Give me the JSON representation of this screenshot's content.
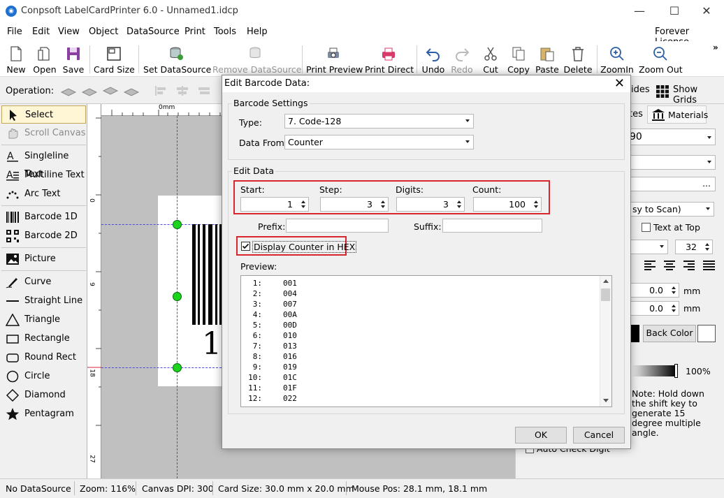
{
  "window": {
    "title": "Conpsoft LabelCardPrinter 6.0 - Unnamed1.idcp",
    "license": "Forever License"
  },
  "menu": [
    "File",
    "Edit",
    "View",
    "Object",
    "DataSource",
    "Print",
    "Tools",
    "Help"
  ],
  "toolbar": {
    "new": "New",
    "open": "Open",
    "save": "Save",
    "card_size": "Card Size",
    "set_datasource": "Set DataSource",
    "remove_datasource": "Remove DataSource",
    "print_preview": "Print Preview",
    "print_direct": "Print Direct",
    "undo": "Undo",
    "redo": "Redo",
    "cut": "Cut",
    "copy": "Copy",
    "paste": "Paste",
    "delete": "Delete",
    "zoom_in": "ZoomIn",
    "zoom_out": "Zoom Out",
    "more": "»"
  },
  "operation_label": "Operation:",
  "guides_label": "ides",
  "show_grids_label": "Show Grids",
  "tools": {
    "select": "Select",
    "scroll_canvas": "Scroll Canvas",
    "singleline_text": "Singleline Text",
    "multiline_text": "Multiline Text",
    "arc_text": "Arc Text",
    "barcode_1d": "Barcode 1D",
    "barcode_2d": "Barcode 2D",
    "picture": "Picture",
    "curve": "Curve",
    "straight_line": "Straight Line",
    "triangle": "Triangle",
    "rectangle": "Rectangle",
    "round_rect": "Round Rect",
    "circle": "Circle",
    "diamond": "Diamond",
    "pentagram": "Pentagram"
  },
  "ruler": {
    "top_origin": "0mm",
    "left": [
      "0",
      "9",
      "18",
      "27"
    ]
  },
  "canvas": {
    "barcode_text": "1"
  },
  "right_panel": {
    "tab_partial": "tes",
    "tab_materials": "Materials",
    "type_partial": "90",
    "readability_partial": "sy to Scan)",
    "text_at_top": "Text at Top",
    "font_size": "32",
    "offset1": "0.0",
    "offset2": "0.0",
    "unit": "mm",
    "back_color": "Back Color",
    "opacity": "100%",
    "note": "Note: Hold down the shift key to generate 15 degree multiple angle.",
    "auto_check_digit": "Auto Check Digit",
    "ellipsis": "..."
  },
  "status": {
    "datasource": "No DataSource",
    "zoom": "Zoom: 116%",
    "dpi": "Canvas DPI: 300",
    "card_size": "Card Size: 30.0 mm x 20.0 mm",
    "mouse_pos": "Mouse Pos: 28.1 mm, 18.1 mm"
  },
  "dialog": {
    "title": "Edit Barcode Data:",
    "close": "✕",
    "barcode_settings": "Barcode Settings",
    "type_label": "Type:",
    "type_value": "7.  Code-128",
    "data_from_label": "Data From:",
    "data_from_value": "Counter",
    "edit_data": "Edit Data",
    "start_label": "Start:",
    "start_value": "1",
    "step_label": "Step:",
    "step_value": "3",
    "digits_label": "Digits:",
    "digits_value": "3",
    "count_label": "Count:",
    "count_value": "100",
    "prefix_label": "Prefix:",
    "prefix_value": "",
    "suffix_label": "Suffix:",
    "suffix_value": "",
    "display_hex_label": "Display Counter in HEX",
    "display_hex_checked": true,
    "preview_label": "Preview:",
    "preview_rows": [
      {
        "n": "1:",
        "v": "001"
      },
      {
        "n": "2:",
        "v": "004"
      },
      {
        "n": "3:",
        "v": "007"
      },
      {
        "n": "4:",
        "v": "00A"
      },
      {
        "n": "5:",
        "v": "00D"
      },
      {
        "n": "6:",
        "v": "010"
      },
      {
        "n": "7:",
        "v": "013"
      },
      {
        "n": "8:",
        "v": "016"
      },
      {
        "n": "9:",
        "v": "019"
      },
      {
        "n": "10:",
        "v": "01C"
      },
      {
        "n": "11:",
        "v": "01F"
      },
      {
        "n": "12:",
        "v": "022"
      }
    ],
    "ok": "OK",
    "cancel": "Cancel"
  }
}
